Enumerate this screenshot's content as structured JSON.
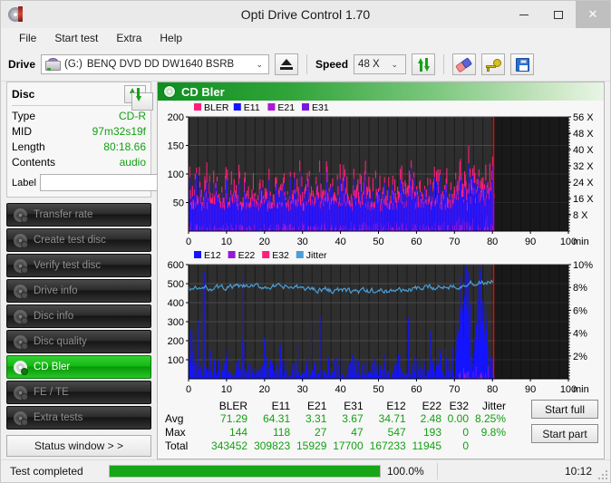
{
  "window": {
    "title": "Opti Drive Control 1.70",
    "app_icon": "disc-icon",
    "minimize": "–",
    "maximize": "□",
    "close": "✕"
  },
  "menu": {
    "items": [
      "File",
      "Start test",
      "Extra",
      "Help"
    ]
  },
  "toolbar": {
    "drive_label": "Drive",
    "drive_letter": "(G:)",
    "drive_name": "BENQ DVD DD DW1640 BSRB",
    "drive_dropdown_arrow": "⌄",
    "eject_icon": "eject-icon",
    "speed_label": "Speed",
    "speed_value": "48 X",
    "speed_dropdown_arrow": "⌄",
    "refresh_icon": "refresh-swap-icon",
    "erase_icon": "eraser-icon",
    "key_icon": "key-icon",
    "save_icon": "save-floppy-icon"
  },
  "disc": {
    "title": "Disc",
    "refresh_icon": "refresh-swap-icon",
    "rows": [
      {
        "key": "Type",
        "value": "CD-R"
      },
      {
        "key": "MID",
        "value": "97m32s19f"
      },
      {
        "key": "Length",
        "value": "80:18.66"
      },
      {
        "key": "Contents",
        "value": "audio"
      }
    ],
    "label_key": "Label",
    "label_value": "",
    "label_placeholder": "",
    "disc_icon": "cd-disc-icon"
  },
  "sidebar": {
    "items": [
      {
        "label": "Transfer rate",
        "active": false
      },
      {
        "label": "Create test disc",
        "active": false
      },
      {
        "label": "Verify test disc",
        "active": false
      },
      {
        "label": "Drive info",
        "active": false
      },
      {
        "label": "Disc info",
        "active": false
      },
      {
        "label": "Disc quality",
        "active": false
      },
      {
        "label": "CD Bler",
        "active": true
      },
      {
        "label": "FE / TE",
        "active": false
      },
      {
        "label": "Extra tests",
        "active": false
      }
    ],
    "status_window": "Status window > >"
  },
  "panel": {
    "title": "CD Bler",
    "icon": "disc-icon"
  },
  "actions": {
    "start_full": "Start full",
    "start_part": "Start part"
  },
  "stats": {
    "columns": [
      "BLER",
      "E11",
      "E21",
      "E31",
      "E12",
      "E22",
      "E32",
      "Jitter"
    ],
    "rows": [
      {
        "name": "Avg",
        "values": [
          "71.29",
          "64.31",
          "3.31",
          "3.67",
          "34.71",
          "2.48",
          "0.00",
          "8.25%"
        ]
      },
      {
        "name": "Max",
        "values": [
          "144",
          "118",
          "27",
          "47",
          "547",
          "193",
          "0",
          "9.8%"
        ]
      },
      {
        "name": "Total",
        "values": [
          "343452",
          "309823",
          "15929",
          "17700",
          "167233",
          "11945",
          "0",
          ""
        ]
      }
    ]
  },
  "statusbar": {
    "message": "Test completed",
    "progress_percent": 100.0,
    "progress_text": "100.0%",
    "elapsed": "10:12"
  },
  "colors": {
    "bler": "#ff1f7a",
    "e11": "#1414ff",
    "e21": "#b016d8",
    "e31": "#7a18e0",
    "e12": "#1414ff",
    "e22": "#9a16d8",
    "e32": "#ff1f7a",
    "jitter": "#4a9fd8",
    "speed_line": "#ff0000",
    "accent_green": "#16a616",
    "plot_bg": "#2e2e2e",
    "value_green": "#13a013"
  },
  "chart_data": [
    {
      "type": "area",
      "name": "CD Bler error chart",
      "title": "",
      "xlabel": "min",
      "ylabel": "",
      "xlim": [
        0,
        100
      ],
      "ylim": [
        0,
        200
      ],
      "xticks": [
        0,
        10,
        20,
        30,
        40,
        50,
        60,
        70,
        80,
        90,
        100
      ],
      "xtick_labels": [
        "0",
        "10",
        "20",
        "30",
        "40",
        "50",
        "60",
        "70",
        "80",
        "90",
        "100"
      ],
      "yticks": [
        50,
        100,
        150,
        200
      ],
      "ytick_labels": [
        "50",
        "100",
        "150",
        "200"
      ],
      "y2label": "",
      "y2ticks": [
        8,
        16,
        24,
        32,
        40,
        48,
        56
      ],
      "y2tick_labels": [
        "8 X",
        "16 X",
        "24 X",
        "32 X",
        "40 X",
        "48 X",
        "56 X"
      ],
      "y2lim": [
        0,
        56
      ],
      "grid": true,
      "legend": [
        "BLER",
        "E11",
        "E21",
        "E31"
      ],
      "legend_position": "top-left",
      "data_end_x": 80.3,
      "speed_line_x": 80.3,
      "series": [
        {
          "name": "BLER",
          "color": "#ff1f7a",
          "avg": 71.29,
          "max": 144,
          "total": 343452
        },
        {
          "name": "E11",
          "color": "#1414ff",
          "avg": 64.31,
          "max": 118,
          "total": 309823
        },
        {
          "name": "E21",
          "color": "#b016d8",
          "avg": 3.31,
          "max": 27,
          "total": 15929
        },
        {
          "name": "E31",
          "color": "#7a18e0",
          "avg": 3.67,
          "max": 47,
          "total": 17700
        }
      ]
    },
    {
      "type": "area",
      "name": "CD Bler E12/E22/E32 and jitter chart",
      "title": "",
      "xlabel": "min",
      "ylabel": "",
      "xlim": [
        0,
        100
      ],
      "ylim": [
        0,
        600
      ],
      "xticks": [
        0,
        10,
        20,
        30,
        40,
        50,
        60,
        70,
        80,
        90,
        100
      ],
      "xtick_labels": [
        "0",
        "10",
        "20",
        "30",
        "40",
        "50",
        "60",
        "70",
        "80",
        "90",
        "100"
      ],
      "yticks": [
        100,
        200,
        300,
        400,
        500,
        600
      ],
      "ytick_labels": [
        "100",
        "200",
        "300",
        "400",
        "500",
        "600"
      ],
      "y2ticks": [
        2,
        4,
        6,
        8,
        10
      ],
      "y2tick_labels": [
        "2%",
        "4%",
        "6%",
        "8%",
        "10%"
      ],
      "y2lim": [
        0,
        10
      ],
      "grid": true,
      "legend": [
        "E12",
        "E22",
        "E32",
        "Jitter"
      ],
      "legend_position": "top-left",
      "data_end_x": 80.3,
      "speed_line_x": 80.3,
      "series": [
        {
          "name": "E12",
          "color": "#1414ff",
          "avg": 34.71,
          "max": 547,
          "total": 167233
        },
        {
          "name": "E22",
          "color": "#9a16d8",
          "avg": 2.48,
          "max": 193,
          "total": 11945
        },
        {
          "name": "E32",
          "color": "#ff1f7a",
          "avg": 0.0,
          "max": 0,
          "total": 0
        },
        {
          "name": "Jitter",
          "color": "#4a9fd8",
          "avg": 8.25,
          "max": 9.8,
          "unit": "%"
        }
      ]
    }
  ]
}
